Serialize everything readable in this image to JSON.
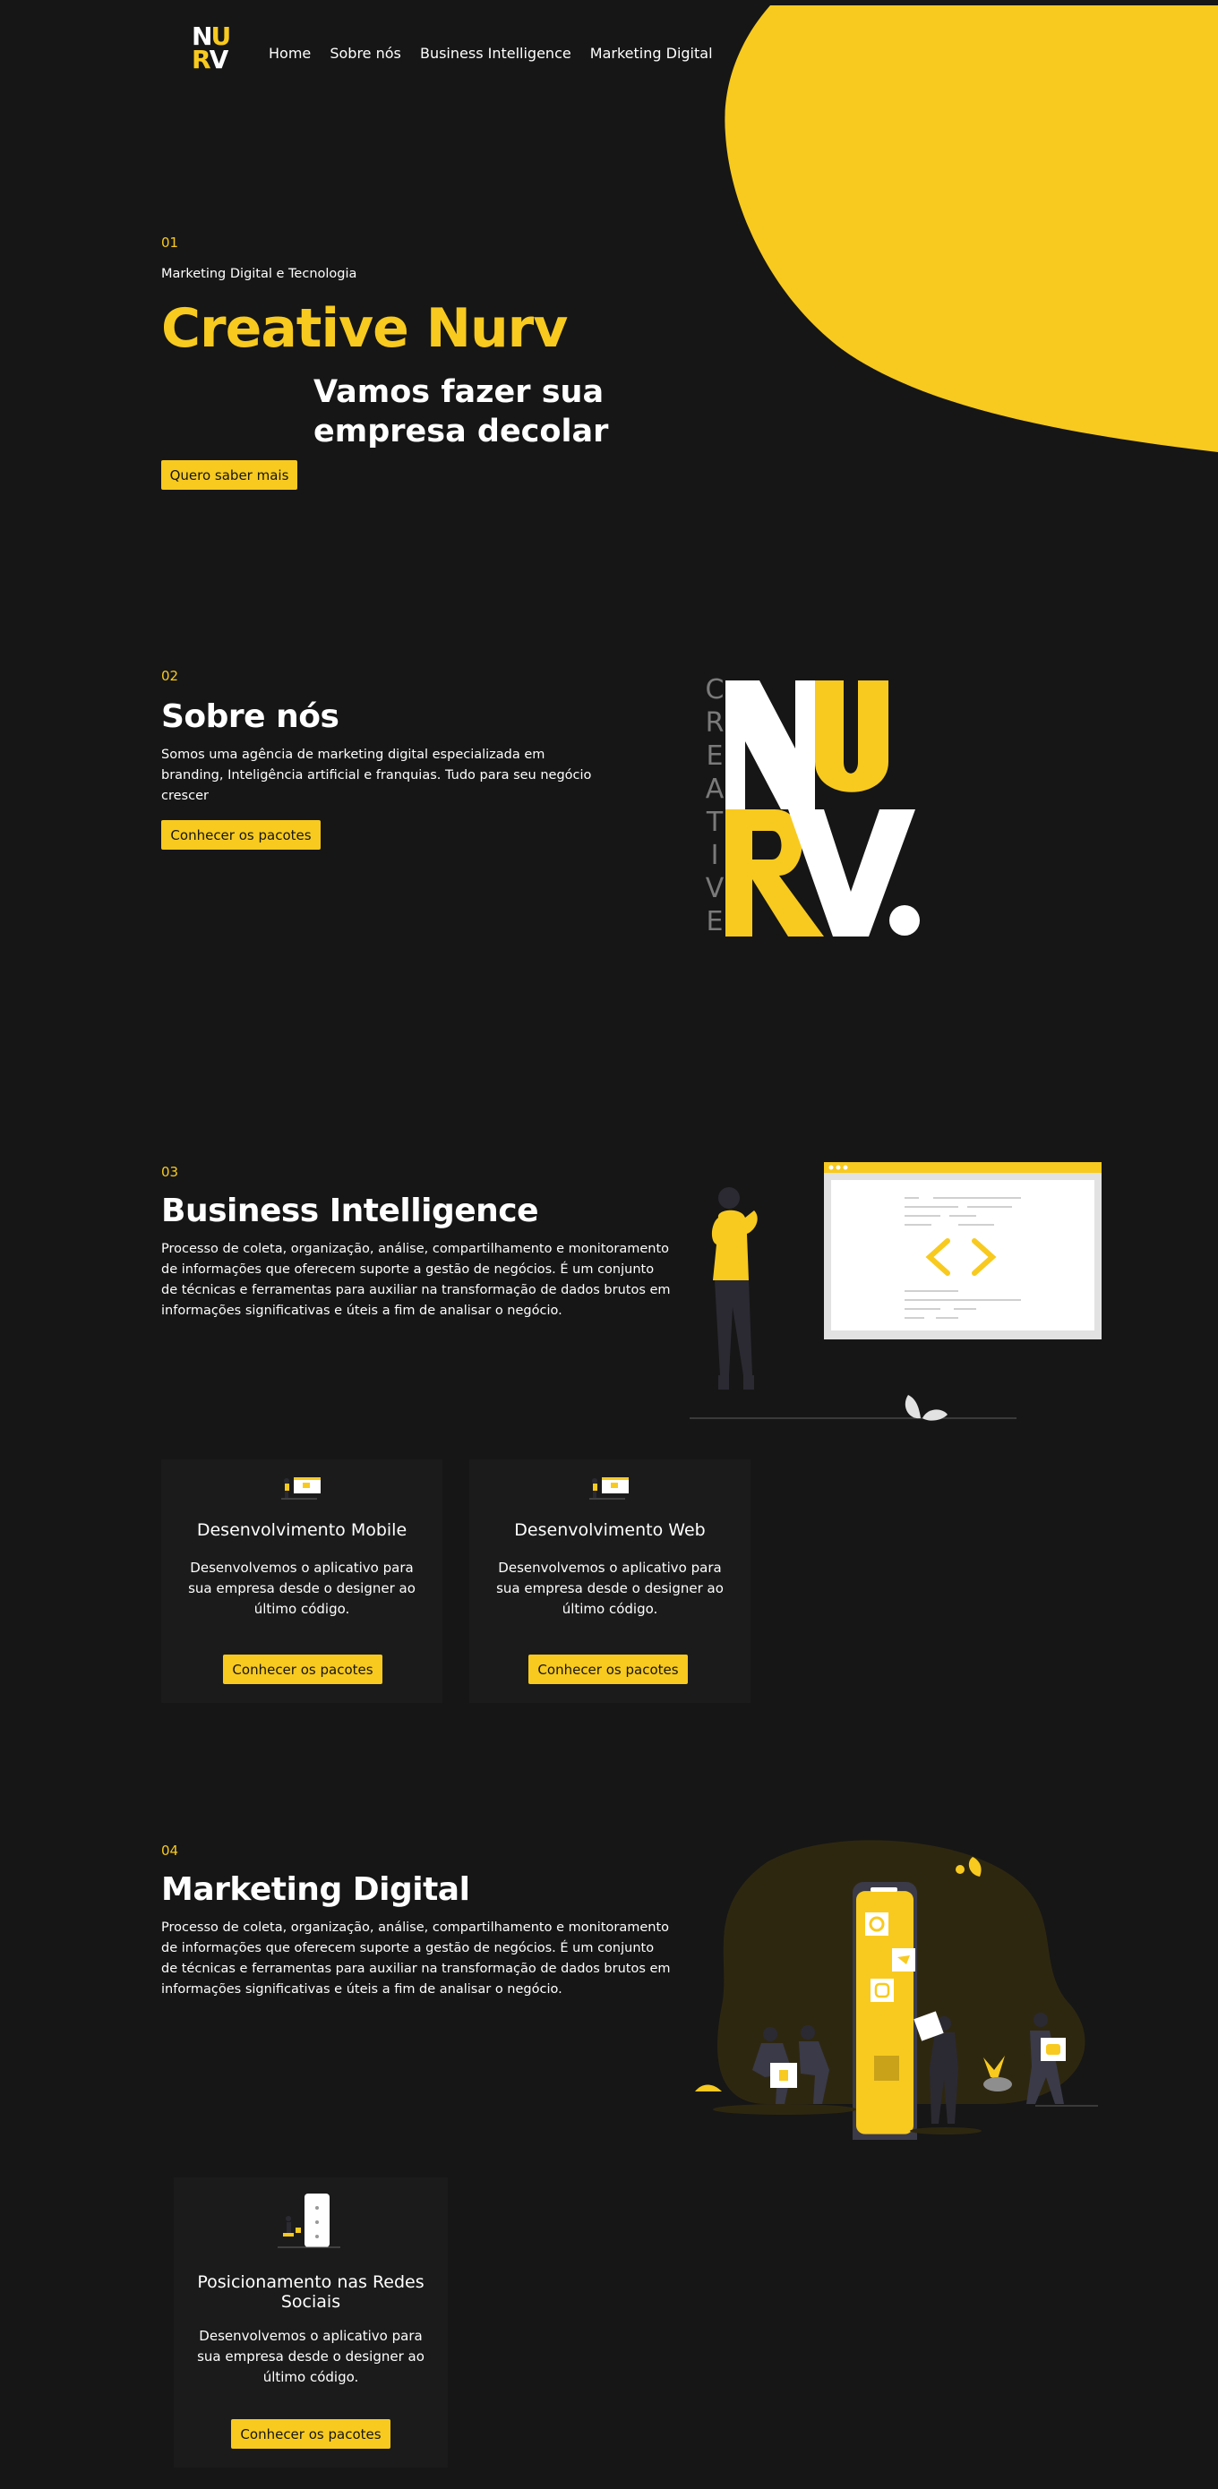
{
  "logo": {
    "line1": "NU",
    "line2": "RV"
  },
  "nav": [
    "Home",
    "Sobre nós",
    "Business Intelligence",
    "Marketing Digital"
  ],
  "hero": {
    "number": "01",
    "eyebrow": "Marketing Digital e Tecnologia",
    "title": "Creative Nurv",
    "subtitle_line1": "Vamos fazer sua",
    "subtitle_line2": "empresa decolar",
    "button": "Quero saber mais"
  },
  "about": {
    "number": "02",
    "title": "Sobre nós",
    "text": "Somos uma agência de marketing digital especializada em branding, Inteligência artificial e franquias. Tudo para seu negócio crescer",
    "button": "Conhecer os pacotes",
    "brand_vertical": [
      "C",
      "R",
      "E",
      "A",
      "T",
      "I",
      "V",
      "E"
    ],
    "brand_big": {
      "n": "N",
      "u": "U",
      "r": "R",
      "v": "V"
    }
  },
  "bi": {
    "number": "03",
    "title": "Business Intelligence",
    "text": "Processo de coleta, organização, análise, compartilhamento e monitoramento de informações que oferecem suporte a gestão de negócios. É um conjunto de técnicas e ferramentas para auxiliar na transformação de dados brutos em informações significativas e úteis a fim de analisar o negócio.",
    "cards": [
      {
        "title": "Desenvolvimento Mobile",
        "text": "Desenvolvemos o aplicativo para sua empresa desde o designer ao último código.",
        "button": "Conhecer os pacotes"
      },
      {
        "title": "Desenvolvimento Web",
        "text": "Desenvolvemos o aplicativo para sua empresa desde o designer ao último código.",
        "button": "Conhecer os pacotes"
      }
    ]
  },
  "marketing": {
    "number": "04",
    "title": "Marketing Digital",
    "text": "Processo de coleta, organização, análise, compartilhamento e monitoramento de informações que oferecem suporte a gestão de negócios. É um conjunto de técnicas e ferramentas para auxiliar na transformação de dados brutos em informações significativas e úteis a fim de analisar o negócio.",
    "card": {
      "title": "Posicionamento nas Redes Sociais",
      "text": "Desenvolvemos o aplicativo para sua empresa desde o designer ao último código.",
      "button": "Conhecer os pacotes"
    }
  },
  "colors": {
    "accent": "#f8ca1f",
    "background": "#161616",
    "card": "#1b1b1b"
  },
  "icons": [
    "code-icon",
    "pinterest-icon",
    "twitter-icon",
    "instagram-icon",
    "facebook-icon",
    "youtube-icon"
  ]
}
